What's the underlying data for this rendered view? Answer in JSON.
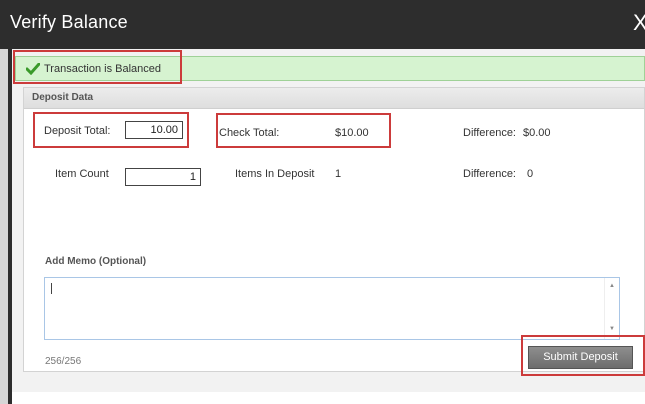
{
  "window": {
    "title": "Verify Balance",
    "close_glyph": "X"
  },
  "status": {
    "message": "Transaction is Balanced",
    "icon": "checkmark-icon",
    "color": "#3a9a2a"
  },
  "deposit_panel": {
    "title": "Deposit Data",
    "deposit_total": {
      "label": "Deposit Total:",
      "value": "10.00"
    },
    "check_total": {
      "label": "Check Total:",
      "value": "$10.00"
    },
    "difference_amount": {
      "label": "Difference:",
      "value": "$0.00"
    },
    "item_count": {
      "label": "Item Count",
      "value": "1"
    },
    "items_in_deposit": {
      "label": "Items In Deposit",
      "value": "1"
    },
    "difference_count": {
      "label": "Difference:",
      "value": "0"
    },
    "memo": {
      "label": "Add Memo (Optional)",
      "value": ""
    },
    "char_counter": "256/256"
  },
  "actions": {
    "submit_label": "Submit Deposit"
  },
  "colors": {
    "titlebar": "#2d2d2d",
    "highlight": "#cc3b3b",
    "status_bg": "#d6f3d0"
  }
}
